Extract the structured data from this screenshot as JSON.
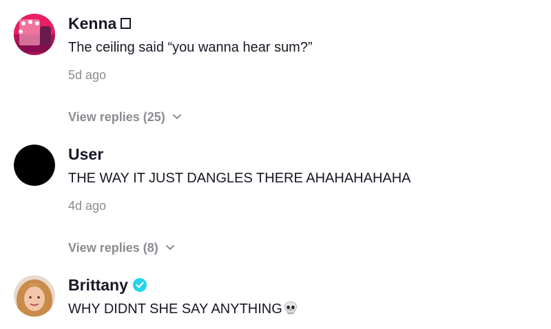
{
  "comments": [
    {
      "username": "Kenna",
      "username_suffix_icon": "missing-glyph-box",
      "text": "The ceiling said “you wanna hear sum?”",
      "time": "5d ago",
      "replies": "View replies (25)",
      "avatar": "pink-mirror-photo"
    },
    {
      "username": "User",
      "text": "THE WAY IT JUST DANGLES THERE AHAHAHAHAHA",
      "time": "4d ago",
      "replies": "View replies (8)",
      "avatar": "black-circle"
    },
    {
      "username": "Brittany",
      "username_suffix_icon": "verified-badge-icon",
      "text": "WHY DIDNT SHE SAY ANYTHING",
      "text_suffix_icon": "skull-emoji",
      "avatar": "blonde-woman-photo"
    }
  ],
  "colors": {
    "text": "#161823",
    "muted": "#8a8b91",
    "verified": "#20d5ec"
  }
}
